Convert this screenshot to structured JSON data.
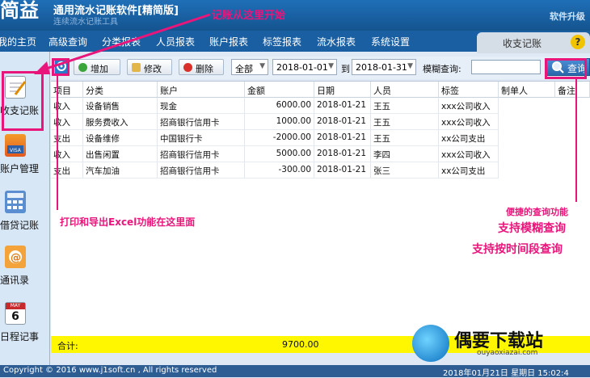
{
  "header": {
    "logo": "简益",
    "app_title": "通用流水记账软件[精简版]",
    "app_subtitle": "连续流水记账工具",
    "upgrade": "软件升级"
  },
  "menu": [
    "我的主页",
    "高级查询",
    "分类报表",
    "人员报表",
    "账户报表",
    "标签报表",
    "流水报表",
    "系统设置"
  ],
  "panel_title": "收支记账",
  "help_icon": "?",
  "sidebar": [
    {
      "label": "收支记账",
      "icon": "notepad-icon"
    },
    {
      "label": "账户管理",
      "icon": "bank-card-icon"
    },
    {
      "label": "借贷记账",
      "icon": "calculator-icon"
    },
    {
      "label": "通讯录",
      "icon": "at-sign-icon"
    },
    {
      "label": "日程记事",
      "icon": "calendar-icon"
    }
  ],
  "calendar_icon": {
    "month": "MAY",
    "day": "6"
  },
  "toolbar": {
    "add": "增加",
    "edit": "修改",
    "delete": "删除",
    "filter_value": "全部",
    "date_from": "2018-01-01",
    "to_label": "到",
    "date_to": "2018-01-31",
    "fuzzy_label": "模糊查询:",
    "search_value": "",
    "query": "查询"
  },
  "table": {
    "columns": [
      "项目",
      "分类",
      "账户",
      "金额",
      "日期",
      "人员",
      "标签",
      "制单人",
      "备注"
    ],
    "rows": [
      [
        "收入",
        "设备销售",
        "现金",
        "6000.00",
        "2018-01-21",
        "王五",
        "xxx公司收入",
        "",
        ""
      ],
      [
        "收入",
        "服务费收入",
        "招商银行信用卡",
        "1000.00",
        "2018-01-21",
        "王五",
        "xxx公司收入",
        "",
        ""
      ],
      [
        "支出",
        "设备维修",
        "中国银行卡",
        "-2000.00",
        "2018-01-21",
        "王五",
        "xx公司支出",
        "",
        ""
      ],
      [
        "收入",
        "出售闲置",
        "招商银行信用卡",
        "5000.00",
        "2018-01-21",
        "李四",
        "xxx公司收入",
        "",
        ""
      ],
      [
        "支出",
        "汽车加油",
        "招商银行信用卡",
        "-300.00",
        "2018-01-21",
        "张三",
        "xx公司支出",
        "",
        ""
      ]
    ],
    "total_label": "合计:",
    "total_value": "9700.00"
  },
  "annotations": {
    "start": "记账从这里开始",
    "print_export": "打印和导出Excel功能在这里面",
    "query_title": "便捷的查询功能",
    "fuzzy": "支持模糊查询",
    "period": "支持按时间段查询"
  },
  "footer": {
    "copyright": "Copyright © 2016 www.j1soft.cn , All rights reserved",
    "datetime": "2018年01月21日 星期日 15:02:4"
  },
  "watermark": {
    "title": "偶要下载站",
    "url": "ouyaoxiazai.com"
  },
  "colors": {
    "accent": "#e8157b",
    "header": "#1a5fa2",
    "total_bar": "#fff700"
  }
}
